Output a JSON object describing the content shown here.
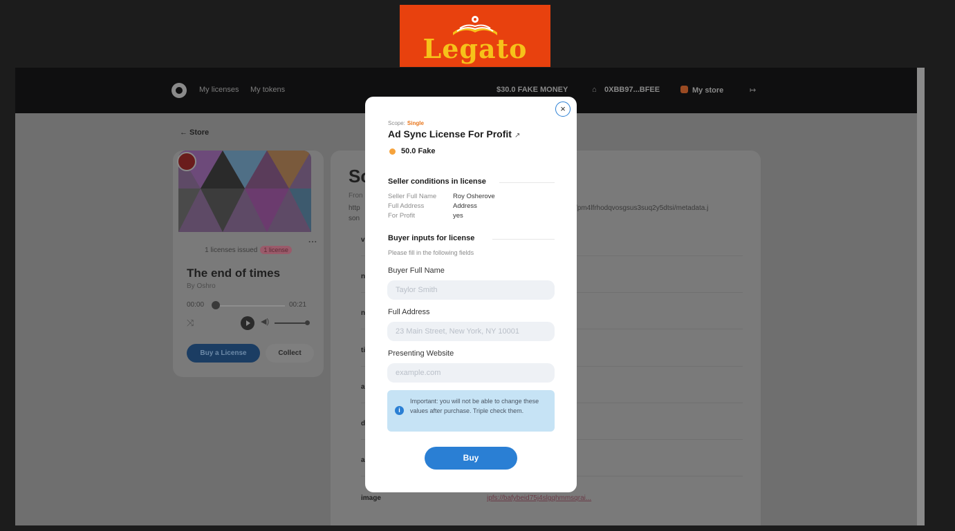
{
  "logo": {
    "text": "Legato"
  },
  "nav": {
    "my_licenses": "My licenses",
    "my_tokens": "My tokens",
    "balance": "$30.0 FAKE MONEY",
    "wallet": "0XBB97...BFEE",
    "my_store": "My store",
    "logout_icon": "logout-icon"
  },
  "page": {
    "back_label": "← Store",
    "heading_partial": "Sc",
    "from_partial": "Fron",
    "url_start_partial": "http",
    "url_end_partial": "/pm4lfrhodqvosgsus3suq2y5dtsi/metadata.j",
    "url_tail_partial": "son",
    "row_keys": [
      "v",
      "n",
      "n",
      "ti",
      "a",
      "d",
      "a"
    ],
    "image_key": "image",
    "image_value": "ipfs://bafybeid75j4slgqhmmsqrai..."
  },
  "track": {
    "licenses_issued": "1 licenses issued",
    "license_pill": "1 license",
    "title": "The end of times",
    "by": "By Oshro",
    "time_start": "00:00",
    "time_end": "00:21",
    "progress": 0.0,
    "buy_label": "Buy a License",
    "collect_label": "Collect",
    "menu": "..."
  },
  "modal": {
    "close_glyph": "×",
    "scope_label": "Scope:",
    "scope_value": "Single",
    "title": "Ad Sync License For Profit",
    "ext_glyph": "↗",
    "price": "50.0 Fake",
    "seller_section": "Seller conditions in license",
    "conditions": [
      {
        "label": "Seller Full Name",
        "value": "Roy Osherove"
      },
      {
        "label": "Full Address",
        "value": "Address"
      },
      {
        "label": "For Profit",
        "value": "yes"
      }
    ],
    "buyer_section": "Buyer inputs for license",
    "fill_note": "Please fill in the following fields",
    "fields": [
      {
        "label": "Buyer Full Name",
        "placeholder": "Taylor Smith",
        "value": ""
      },
      {
        "label": "Full Address",
        "placeholder": "23 Main Street, New York, NY 10001",
        "value": ""
      },
      {
        "label": "Presenting Website",
        "placeholder": "example.com",
        "value": ""
      }
    ],
    "notice": "Important: you will not be able to change these values after purchase. Triple check them.",
    "buy_label": "Buy"
  },
  "colors": {
    "accent": "#2a7fd4",
    "scope": "#e8751a",
    "logo_bg": "#e8410e",
    "logo_text": "#f6c21a"
  }
}
